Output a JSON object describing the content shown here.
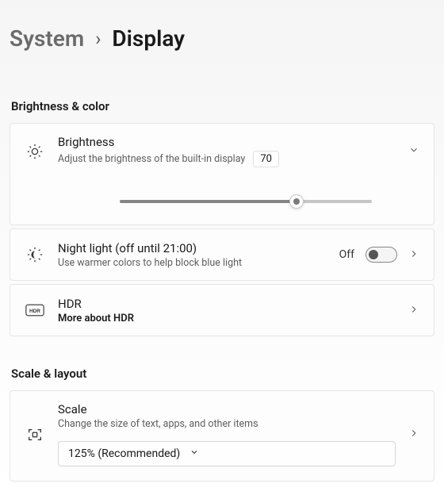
{
  "breadcrumb": {
    "parent": "System",
    "separator": "›",
    "current": "Display"
  },
  "sections": {
    "brightness_color": {
      "header": "Brightness & color",
      "brightness": {
        "title": "Brightness",
        "subtitle": "Adjust the brightness of the built-in display",
        "value": "70"
      },
      "night_light": {
        "title": "Night light (off until 21:00)",
        "subtitle": "Use warmer colors to help block blue light",
        "state_label": "Off"
      },
      "hdr": {
        "title": "HDR",
        "link": "More about HDR"
      }
    },
    "scale_layout": {
      "header": "Scale & layout",
      "scale": {
        "title": "Scale",
        "subtitle": "Change the size of text, apps, and other items",
        "selected": "125% (Recommended)"
      }
    }
  }
}
